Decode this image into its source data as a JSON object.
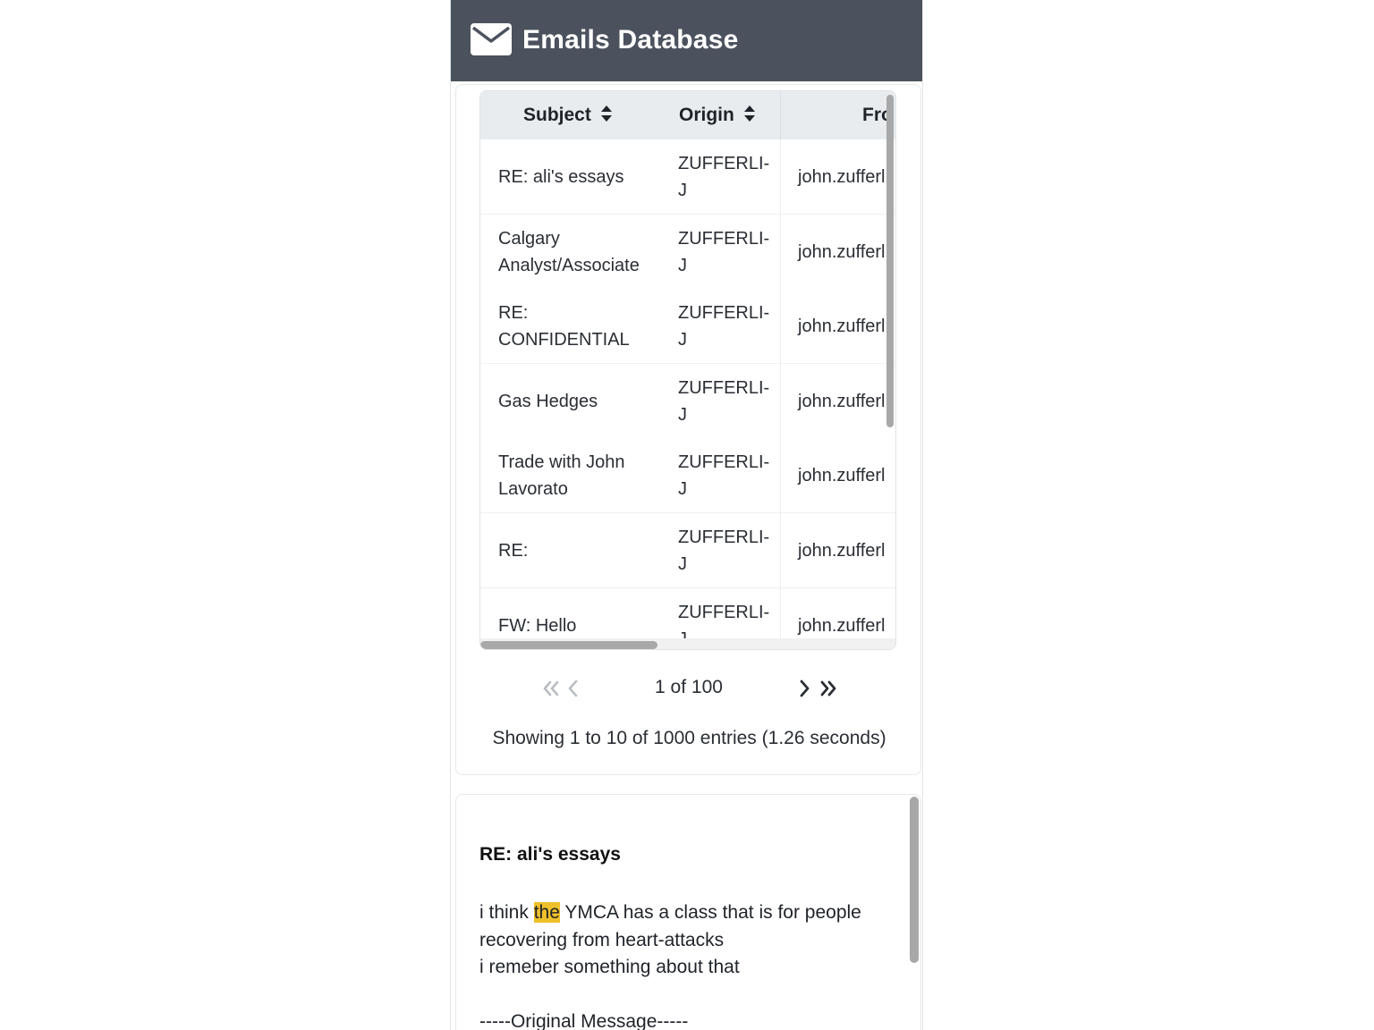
{
  "header": {
    "title": "Emails Database",
    "icon": "envelope-icon"
  },
  "table": {
    "columns": [
      {
        "label": "Subject",
        "sort_icon": "sort-icon"
      },
      {
        "label": "Origin",
        "sort_icon": "sort-icon"
      },
      {
        "label": "Fro"
      }
    ],
    "rows": [
      {
        "subject": [
          "RE: ali's essays"
        ],
        "origin": [
          "ZUFFERLI-",
          "J"
        ],
        "from": "john.zufferl"
      },
      {
        "subject": [
          "Calgary",
          "Analyst/Associate"
        ],
        "origin": [
          "ZUFFERLI-",
          "J"
        ],
        "from": "john.zufferl"
      },
      {
        "subject": [
          "RE:",
          "CONFIDENTIAL"
        ],
        "origin": [
          "ZUFFERLI-",
          "J"
        ],
        "from": "john.zufferl"
      },
      {
        "subject": [
          "Gas Hedges"
        ],
        "origin": [
          "ZUFFERLI-",
          "J"
        ],
        "from": "john.zufferl"
      },
      {
        "subject": [
          "Trade with John",
          "Lavorato"
        ],
        "origin": [
          "ZUFFERLI-",
          "J"
        ],
        "from": "john.zufferl"
      },
      {
        "subject": [
          "RE:"
        ],
        "origin": [
          "ZUFFERLI-",
          "J"
        ],
        "from": "john.zufferl"
      },
      {
        "subject": [
          "FW: Hello"
        ],
        "origin": [
          "ZUFFERLI-",
          "J"
        ],
        "from": "john.zufferl"
      }
    ]
  },
  "pagination": {
    "first_icon": "double-chevron-left-icon",
    "prev_icon": "chevron-left-icon",
    "next_icon": "chevron-right-icon",
    "last_icon": "double-chevron-right-icon",
    "page_text": "1 of 100",
    "entries_text": "Showing 1 to 10 of 1000 entries (1.26 seconds)"
  },
  "detail": {
    "subject": "RE: ali's essays",
    "body": {
      "line1_before": "i think ",
      "line1_highlight": "the",
      "line1_after": " YMCA has a class that is for people",
      "line2": "recovering from heart-attacks",
      "line3": "i remeber something about that",
      "line4": "",
      "line5": "-----Original Message-----"
    }
  },
  "colors": {
    "header_bg": "#4b525e",
    "table_header_bg": "#e9ecef",
    "highlight": "#efc02a",
    "disabled_pager": "#b9bec4"
  }
}
